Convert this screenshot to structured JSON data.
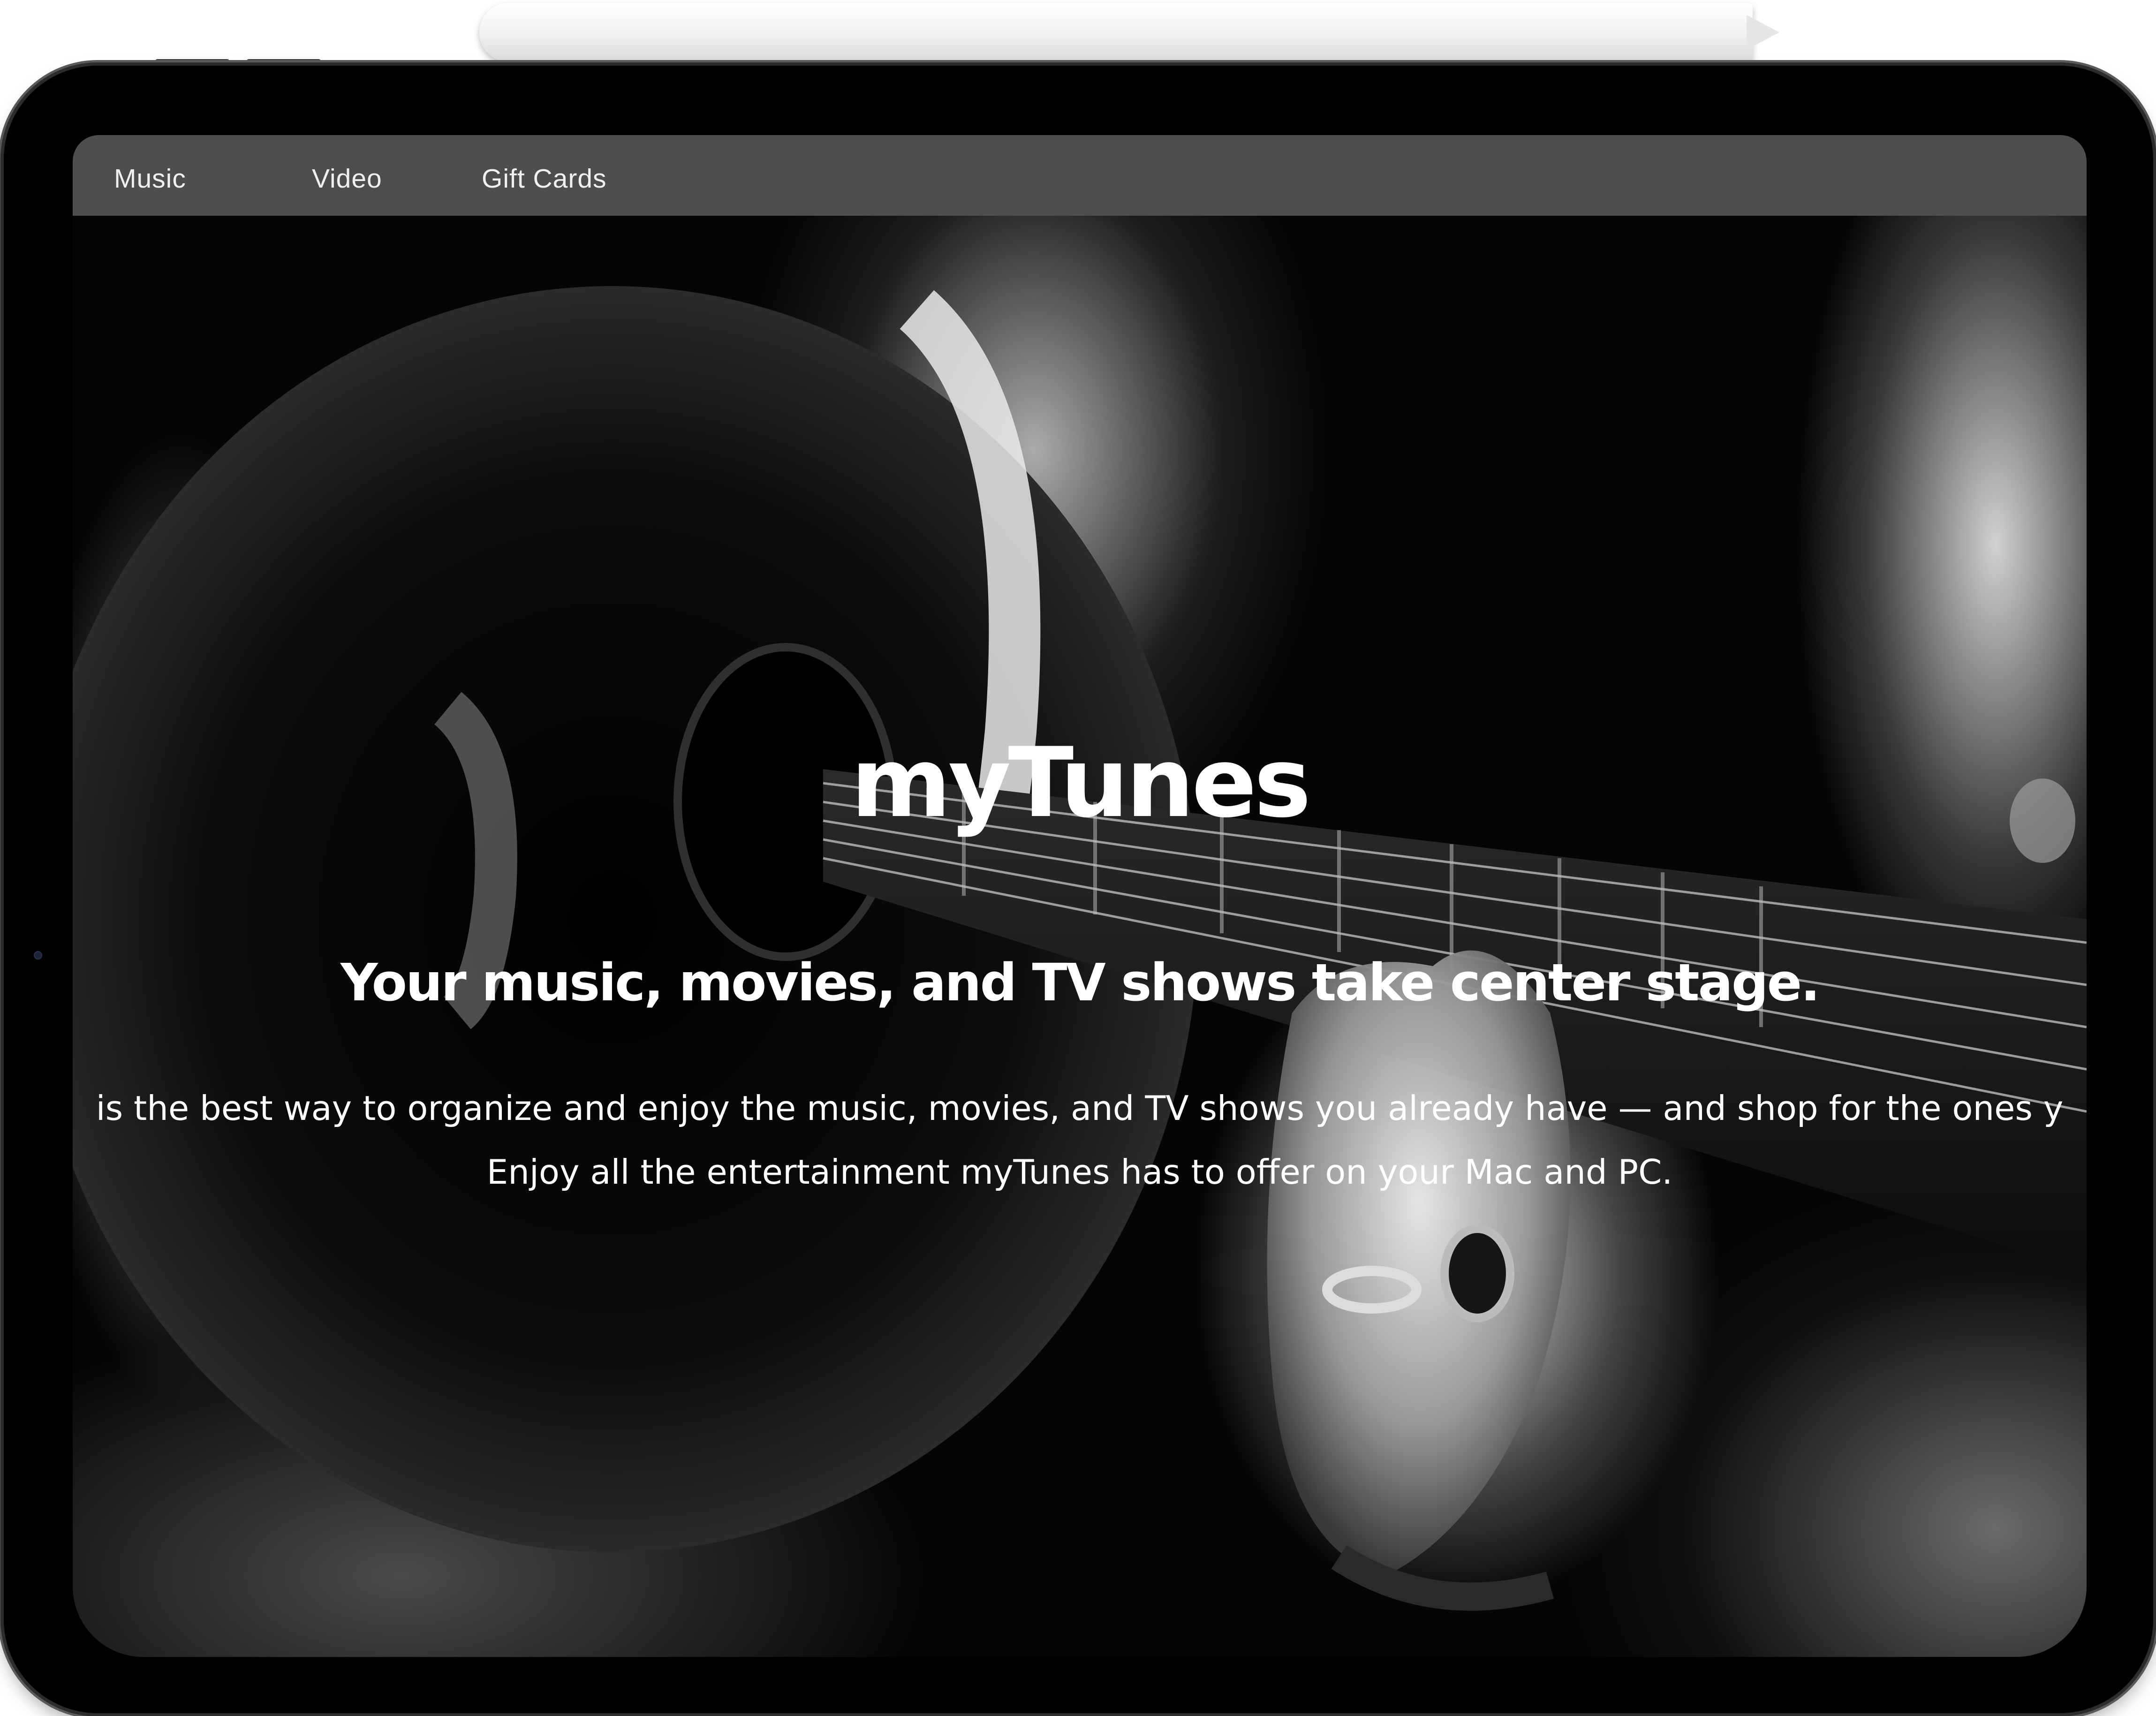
{
  "nav": {
    "items": [
      {
        "label": "Music"
      },
      {
        "label": "Video"
      },
      {
        "label": "Gift Cards"
      }
    ]
  },
  "hero": {
    "title": "myTunes",
    "subtitle": "Your music, movies, and TV shows take center stage.",
    "body_line1": "is the best way to organize and enjoy the music, movies, and TV shows you already have — and shop for the ones y",
    "body_line2": "Enjoy all the entertainment myTunes has to offer on your Mac and PC."
  },
  "colors": {
    "nav_bar": "#4e4e4e",
    "nav_text": "#f0f0f0",
    "hero_text": "#ffffff",
    "device_frame": "#000000"
  }
}
